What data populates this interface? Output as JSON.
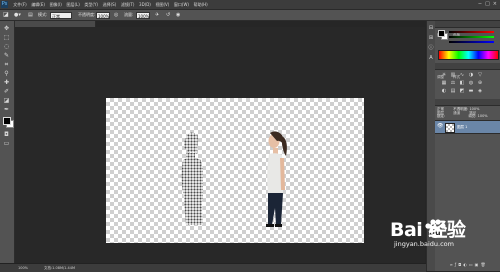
{
  "app": {
    "logo_text": "Ps"
  },
  "menubar": {
    "items": [
      "文件(F)",
      "编辑(E)",
      "图像(I)",
      "图层(L)",
      "类型(Y)",
      "选择(S)",
      "滤镜(T)",
      "3D(D)",
      "视图(V)",
      "窗口(W)",
      "帮助(H)"
    ],
    "window_buttons": [
      "−",
      "□",
      "×"
    ]
  },
  "options_bar": {
    "mode_label": "模式:",
    "mode_value": "正常",
    "opacity_label": "不透明度:",
    "opacity_value": "100%",
    "flow_label": "流量:",
    "flow_value": "100%"
  },
  "document": {
    "tab_title": "Song 3.jpg @ 100% (图层 1, RGB/8) *"
  },
  "status_bar": {
    "zoom": "100%",
    "doc_size": "文档:1.08M/1.44M"
  },
  "panels": {
    "color_tabs": [
      "颜色",
      "色板"
    ],
    "adjust_tabs": [
      "调整",
      "样式"
    ],
    "layers_tabs": [
      "图层",
      "通道",
      "路径"
    ],
    "blend_mode": "正常",
    "opacity_label": "不透明度:",
    "opacity_value": "100%",
    "lock_label": "锁定:",
    "fill_label": "填充:",
    "fill_value": "100%",
    "layers": [
      {
        "name": "图层 1"
      }
    ]
  },
  "watermark": {
    "brand": "Bai 经验",
    "url": "jingyan.baidu.com"
  },
  "colors": {
    "foreground": "#000000",
    "background": "#ffffff",
    "selected_layer": "#6a86a8"
  }
}
